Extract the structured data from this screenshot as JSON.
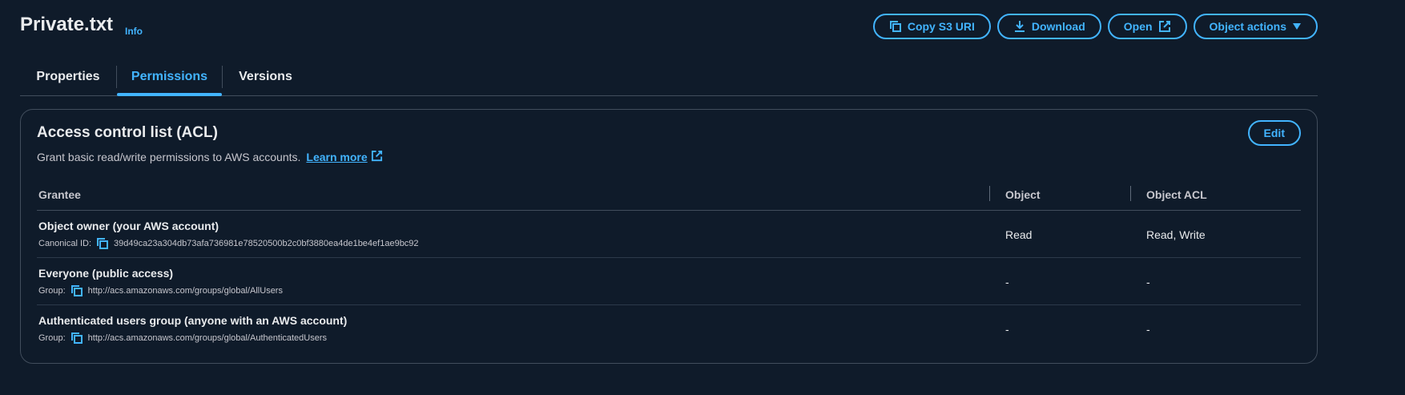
{
  "header": {
    "title": "Private.txt",
    "info_label": "Info",
    "buttons": {
      "copy_uri": "Copy S3 URI",
      "download": "Download",
      "open": "Open",
      "object_actions": "Object actions"
    }
  },
  "tabs": [
    {
      "label": "Properties"
    },
    {
      "label": "Permissions",
      "active": true
    },
    {
      "label": "Versions"
    }
  ],
  "acl": {
    "title": "Access control list (ACL)",
    "description": "Grant basic read/write permissions to AWS accounts.",
    "learn_more": "Learn more",
    "edit_label": "Edit",
    "columns": [
      "Grantee",
      "Object",
      "Object ACL"
    ],
    "rows": [
      {
        "name": "Object owner (your AWS account)",
        "sub_label": "Canonical ID:",
        "sub_value": "39d49ca23a304db73afa736981e78520500b2c0bf3880ea4de1be4ef1ae9bc92",
        "object": "Read",
        "object_acl": "Read, Write"
      },
      {
        "name": "Everyone (public access)",
        "sub_label": "Group:",
        "sub_value": "http://acs.amazonaws.com/groups/global/AllUsers",
        "object": "-",
        "object_acl": "-"
      },
      {
        "name": "Authenticated users group (anyone with an AWS account)",
        "sub_label": "Group:",
        "sub_value": "http://acs.amazonaws.com/groups/global/AuthenticatedUsers",
        "object": "-",
        "object_acl": "-"
      }
    ]
  },
  "colors": {
    "accent": "#42b4ff",
    "background": "#0f1b2a",
    "border": "#414d5c"
  }
}
